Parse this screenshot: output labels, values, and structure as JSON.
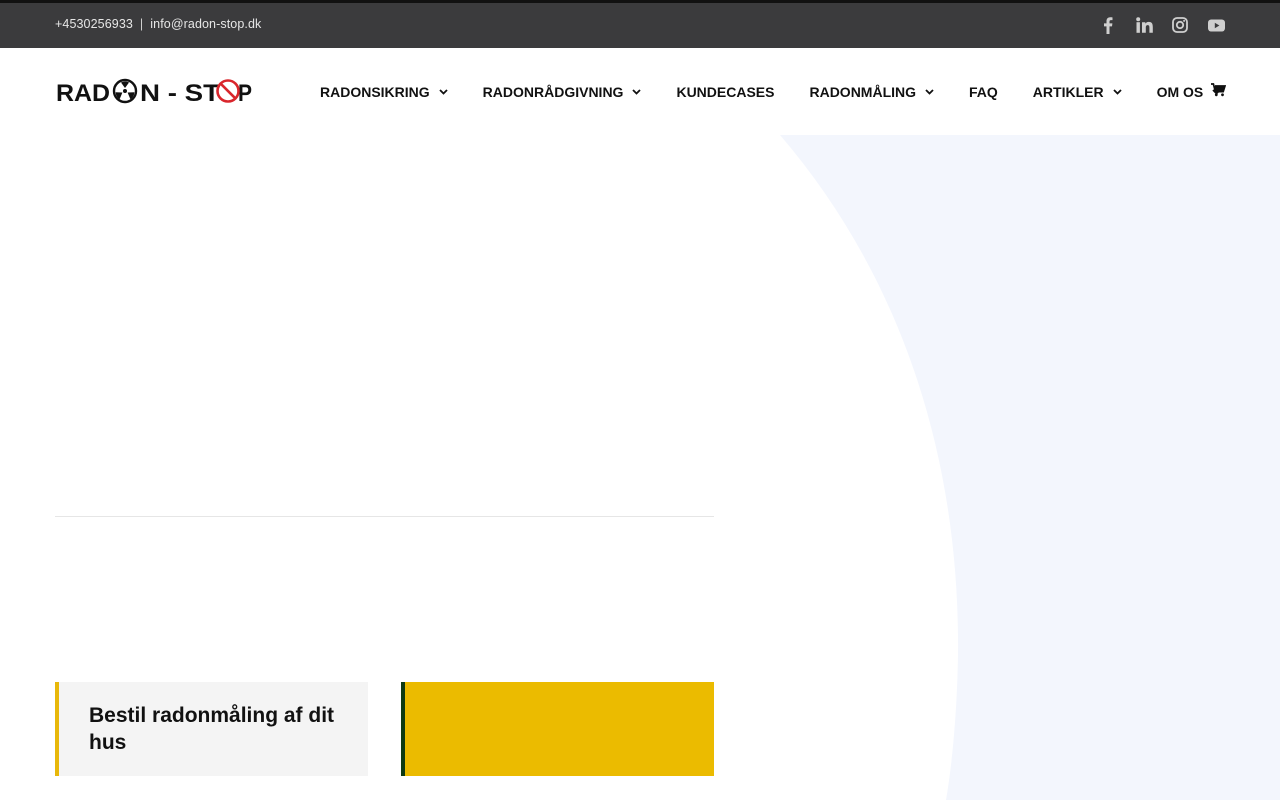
{
  "topbar": {
    "phone": "+4530256933",
    "separator": "|",
    "email": "info@radon-stop.dk",
    "social": [
      "facebook-icon",
      "linkedin-icon",
      "instagram-icon",
      "youtube-icon"
    ]
  },
  "header": {
    "logo_text": "RAD◎N - ST◎P",
    "nav": [
      {
        "label": "RADONSIKRING",
        "has_dropdown": true
      },
      {
        "label": "RADONRÅDGIVNING",
        "has_dropdown": true
      },
      {
        "label": "KUNDECASES",
        "has_dropdown": false
      },
      {
        "label": "RADONMÅLING",
        "has_dropdown": true
      },
      {
        "label": "FAQ",
        "has_dropdown": false
      },
      {
        "label": "ARTIKLER",
        "has_dropdown": true
      },
      {
        "label": "OM OS",
        "has_dropdown": true
      }
    ]
  },
  "cards": {
    "left_title": "Bestil radonmåling af dit hus"
  },
  "colors": {
    "topbar_bg": "#3b3b3d",
    "accent_yellow": "#ebbb00",
    "accent_green": "#0e3a12",
    "shape_bg": "#f3f6fd",
    "logo_red": "#d9262c"
  }
}
